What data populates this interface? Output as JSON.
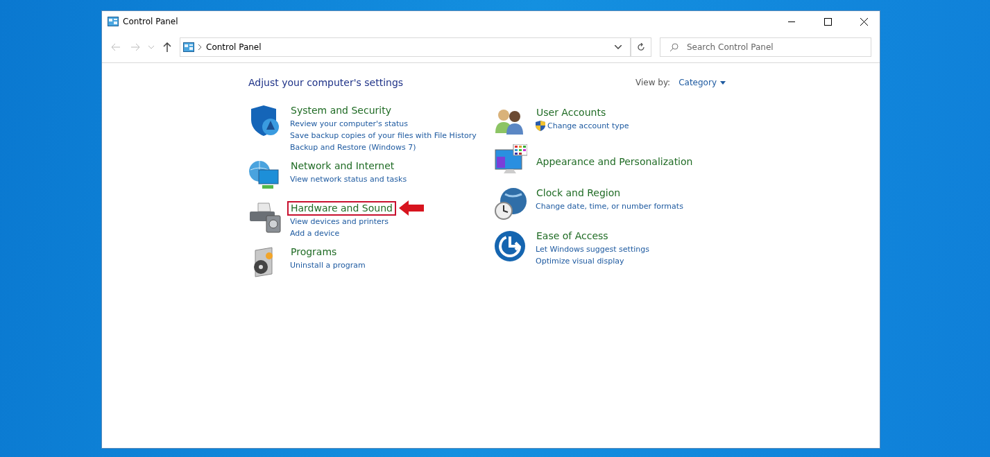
{
  "window": {
    "title": "Control Panel"
  },
  "address_bar": {
    "path": "Control Panel"
  },
  "search": {
    "placeholder": "Search Control Panel"
  },
  "heading": "Adjust your computer's settings",
  "view_by": {
    "label": "View by:",
    "value": "Category"
  },
  "columns": [
    {
      "categories": [
        {
          "kind": "security",
          "title": "System and Security",
          "highlighted": false,
          "links": [
            {
              "text": "Review your computer's status",
              "shield": false
            },
            {
              "text": "Save backup copies of your files with File History",
              "shield": false
            },
            {
              "text": "Backup and Restore (Windows 7)",
              "shield": false
            }
          ]
        },
        {
          "kind": "network",
          "title": "Network and Internet",
          "highlighted": false,
          "links": [
            {
              "text": "View network status and tasks",
              "shield": false
            }
          ]
        },
        {
          "kind": "hardware",
          "title": "Hardware and Sound",
          "highlighted": true,
          "links": [
            {
              "text": "View devices and printers",
              "shield": false
            },
            {
              "text": "Add a device",
              "shield": false
            }
          ]
        },
        {
          "kind": "programs",
          "title": "Programs",
          "highlighted": false,
          "links": [
            {
              "text": "Uninstall a program",
              "shield": false
            }
          ]
        }
      ]
    },
    {
      "categories": [
        {
          "kind": "users",
          "title": "User Accounts",
          "highlighted": false,
          "links": [
            {
              "text": "Change account type",
              "shield": true
            }
          ]
        },
        {
          "kind": "appearance",
          "title": "Appearance and Personalization",
          "highlighted": false
        },
        {
          "kind": "clock",
          "title": "Clock and Region",
          "highlighted": false,
          "links": [
            {
              "text": "Change date, time, or number formats",
              "shield": false
            }
          ]
        },
        {
          "kind": "access",
          "title": "Ease of Access",
          "highlighted": false,
          "links": [
            {
              "text": "Let Windows suggest settings",
              "shield": false
            },
            {
              "text": "Optimize visual display",
              "shield": false
            }
          ]
        }
      ]
    }
  ]
}
